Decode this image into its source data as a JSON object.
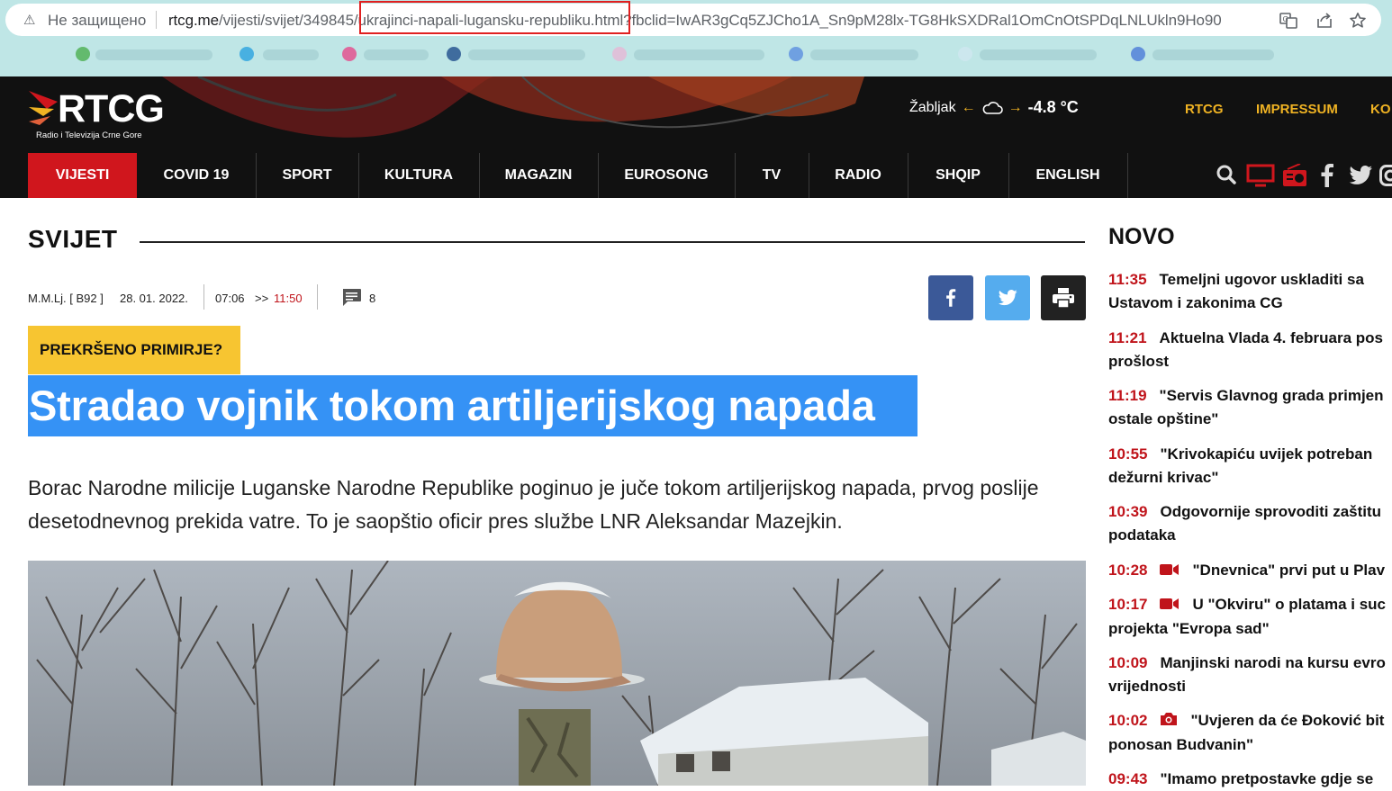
{
  "browser": {
    "insecure_label": "Не защищено",
    "url_domain": "rtcg.me",
    "url_path": "/vijesti/svijet/349845/ukrajinci-napali-lugansku-republiku.html?fbclid=IwAR3gCq5ZJCho1A_Sn9pM28lx-TG8HkSXDRal1OmCnOtSPDqLNLUkln9Ho90"
  },
  "site": {
    "logo_text": "RTCG",
    "logo_subtitle": "Radio i Televizija Crne Gore",
    "weather_city": "Žabljak",
    "weather_temp": "-4.8 °C",
    "toplinks": [
      "RTCG",
      "IMPRESSUM",
      "KO"
    ]
  },
  "nav": {
    "items": [
      "VIJESTI",
      "COVID 19",
      "SPORT",
      "KULTURA",
      "MAGAZIN",
      "EUROSONG",
      "TV",
      "RADIO",
      "SHQIP",
      "ENGLISH"
    ]
  },
  "article": {
    "section": "SVIJET",
    "author": "M.M.Lj. [ B92 ]",
    "date": "28. 01. 2022.",
    "time_published": "07:06",
    "time_sep": ">>",
    "time_updated": "11:50",
    "comments": "8",
    "kicker": "PREKRŠENO PRIMIRJE?",
    "headline": "Stradao vojnik tokom artiljerijskog napada",
    "lead": "Borac Narodne milicije Luganske Narodne Republike poginuo je juče tokom artiljerijskog napada, prvog poslije desetodnevnog prekida vatre. To je saopštio oficir pres službe LNR Aleksandar Mazejkin."
  },
  "sidebar": {
    "title": "NOVO",
    "items": [
      {
        "time": "11:35",
        "icon": "",
        "line1": "Temeljni ugovor uskladiti sa",
        "line2": "Ustavom i zakonima CG"
      },
      {
        "time": "11:21",
        "icon": "",
        "line1": "Aktuelna Vlada 4. februara pos",
        "line2": "prošlost"
      },
      {
        "time": "11:19",
        "icon": "",
        "line1": "\"Servis Glavnog grada primjen",
        "line2": "ostale opštine\""
      },
      {
        "time": "10:55",
        "icon": "",
        "line1": "\"Krivokapiću uvijek potreban",
        "line2": "dežurni krivac\""
      },
      {
        "time": "10:39",
        "icon": "",
        "line1": "Odgovornije sprovoditi zaštitu",
        "line2": "podataka"
      },
      {
        "time": "10:28",
        "icon": "video-icon",
        "line1": "\"Dnevnica\" prvi put u Plav",
        "line2": ""
      },
      {
        "time": "10:17",
        "icon": "video-icon",
        "line1": "U \"Okviru\" o platama i suc",
        "line2": "projekta \"Evropa sad\""
      },
      {
        "time": "10:09",
        "icon": "",
        "line1": "Manjinski narodi na kursu evro",
        "line2": "vrijednosti"
      },
      {
        "time": "10:02",
        "icon": "camera-icon",
        "line1": "\"Uvjeren da će Đoković bit",
        "line2": "ponosan Budvanin\""
      },
      {
        "time": "09:43",
        "icon": "",
        "line1": "\"Imamo pretpostavke gdje se",
        "line2": ""
      }
    ]
  },
  "colors": {
    "brand_red": "#d0161d",
    "brand_yellow": "#f0b323",
    "highlight_blue": "#3592f5",
    "kicker_yellow": "#f7c531",
    "facebook": "#3b5998",
    "twitter": "#55acee"
  }
}
